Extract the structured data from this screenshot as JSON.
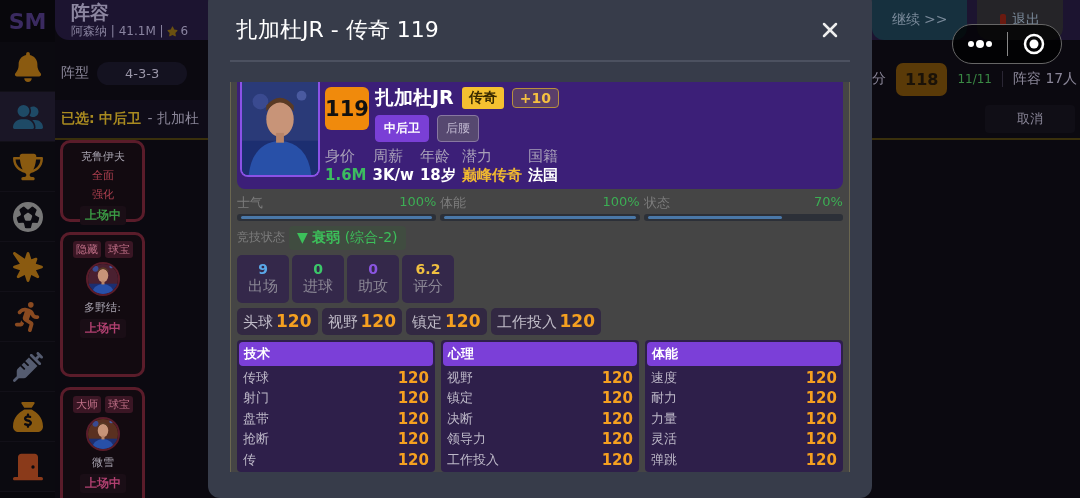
{
  "sidebar": {
    "logo": "SM",
    "items": [
      {
        "selected": false
      },
      {
        "selected": true
      },
      {
        "selected": false
      },
      {
        "selected": false
      },
      {
        "selected": false
      },
      {
        "selected": false
      },
      {
        "selected": false
      },
      {
        "selected": false
      },
      {
        "selected": false
      }
    ]
  },
  "header": {
    "title": "阵容",
    "subtitle": "阿森纳 | 41.1M |",
    "rating": "6",
    "buttons": [
      {
        "label": "继续 >>",
        "kind": "continue"
      },
      {
        "label": "退出",
        "kind": "exit"
      }
    ]
  },
  "formation": {
    "label": "阵型",
    "value": "4-3-3"
  },
  "summary": {
    "score_label": "分",
    "score": "118",
    "count": "11/11",
    "squad": "阵容 17人"
  },
  "selection": {
    "label": "已选: 中后卫",
    "text": "- 扎加杜",
    "cancel": "取消"
  },
  "bench": [
    {
      "name": "克鲁伊夫",
      "notes": [
        "全面",
        "强化"
      ],
      "status": "上场中",
      "color": "#3a9a44"
    },
    {
      "name": "多野结:",
      "tags": [
        "隐藏",
        "球宝"
      ],
      "status": "上场中",
      "color": "#b04070"
    },
    {
      "name": "微雪",
      "tags": [
        "大师",
        "球宝"
      ],
      "status": "上场中",
      "color": "#b04070"
    }
  ],
  "modal": {
    "title": "扎加杜JR - 传奇 119",
    "player": {
      "rating": "119",
      "name": "扎加杜JR",
      "grade": "传奇",
      "bonus": "+10",
      "positions": [
        {
          "label": "中后卫",
          "selected": true
        },
        {
          "label": "后腰",
          "selected": false
        }
      ],
      "facts": [
        {
          "label": "身价",
          "value": "1.6M",
          "kind": "money"
        },
        {
          "label": "周薪",
          "value": "3K/w",
          "kind": "plain"
        },
        {
          "label": "年龄",
          "value": "18岁",
          "kind": "plain"
        },
        {
          "label": "潜力",
          "value": "巅峰传奇",
          "kind": "gold"
        },
        {
          "label": "国籍",
          "value": "法国",
          "kind": "plain"
        }
      ]
    },
    "meters": [
      {
        "label": "士气",
        "reading": "100%",
        "level": 1
      },
      {
        "label": "体能",
        "reading": "100%",
        "level": 1
      },
      {
        "label": "状态",
        "reading": "70%",
        "level": 0.7
      }
    ],
    "form": {
      "label": "竞技状态",
      "value": "▼ **衰弱** (综合-2)"
    },
    "stats": [
      {
        "value": "9",
        "label": "出场",
        "color": "#5aa8e8"
      },
      {
        "value": "0",
        "label": "进球",
        "color": "#3cc86a"
      },
      {
        "value": "0",
        "label": "助攻",
        "color": "#8a55e0"
      },
      {
        "value": "6.2",
        "label": "评分",
        "color": "#f0c040"
      }
    ],
    "key_attributes": [
      {
        "label": "头球",
        "value": "120"
      },
      {
        "label": "视野",
        "value": "120"
      },
      {
        "label": "镇定",
        "value": "120"
      },
      {
        "label": "工作投入",
        "value": "120"
      }
    ],
    "attribute_groups": [
      {
        "title": "技术",
        "rows": [
          {
            "label": "传球",
            "value": "120"
          },
          {
            "label": "射门",
            "value": "120"
          },
          {
            "label": "盘带",
            "value": "120"
          },
          {
            "label": "抢断",
            "value": "120"
          },
          {
            "label": "传",
            "value": "120"
          }
        ]
      },
      {
        "title": "心理",
        "rows": [
          {
            "label": "视野",
            "value": "120"
          },
          {
            "label": "镇定",
            "value": "120"
          },
          {
            "label": "决断",
            "value": "120"
          },
          {
            "label": "领导力",
            "value": "120"
          },
          {
            "label": "工作投入",
            "value": "120"
          }
        ]
      },
      {
        "title": "体能",
        "rows": [
          {
            "label": "速度",
            "value": "120"
          },
          {
            "label": "耐力",
            "value": "120"
          },
          {
            "label": "力量",
            "value": "120"
          },
          {
            "label": "灵活",
            "value": "120"
          },
          {
            "label": "弹跳",
            "value": "120"
          }
        ]
      }
    ]
  }
}
